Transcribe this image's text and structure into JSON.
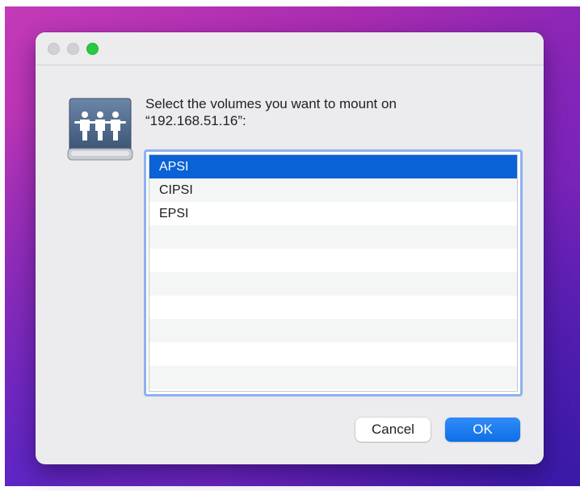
{
  "dialog": {
    "prompt_line1": "Select the volumes you want to mount on",
    "prompt_line2": "“192.168.51.16”:",
    "icon": "shared-network-drive-icon"
  },
  "volumes": {
    "items": [
      "APSI",
      "CIPSI",
      "EPSI",
      "",
      "",
      "",
      "",
      "",
      "",
      ""
    ],
    "selected": "APSI"
  },
  "buttons": {
    "cancel_label": "Cancel",
    "ok_label": "OK"
  },
  "colors": {
    "selection": "#0a63d6",
    "accent_button": "#1b78ee",
    "zoom_light": "#29c940"
  }
}
